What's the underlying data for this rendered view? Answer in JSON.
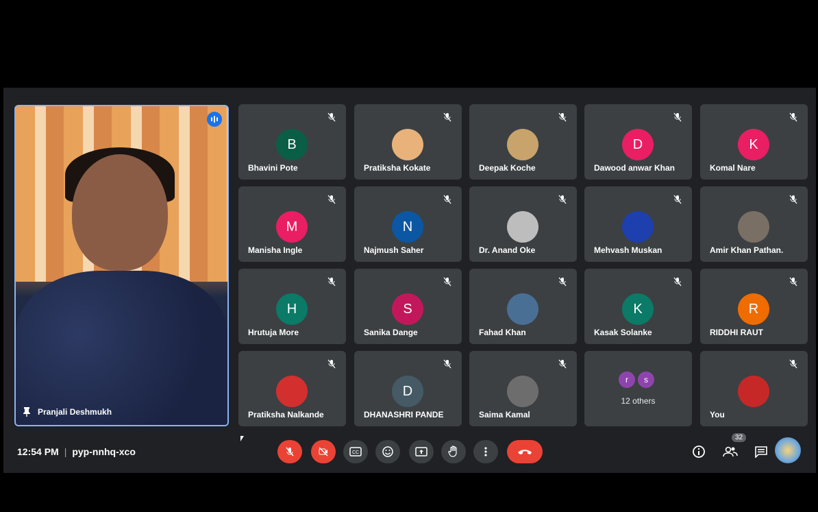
{
  "featured": {
    "name": "Pranjali Deshmukh"
  },
  "tiles": [
    {
      "name": "Bhavini Pote",
      "initial": "B",
      "color": "#0b5e46"
    },
    {
      "name": "Pratiksha Kokate",
      "initial": "",
      "color": "#e9b27a"
    },
    {
      "name": "Deepak Koche",
      "initial": "",
      "color": "#c8a36b"
    },
    {
      "name": "Dawood anwar Khan",
      "initial": "D",
      "color": "#e91e63"
    },
    {
      "name": "Komal Nare",
      "initial": "K",
      "color": "#e91e63"
    },
    {
      "name": "Manisha Ingle",
      "initial": "M",
      "color": "#e91e63"
    },
    {
      "name": "Najmush Saher",
      "initial": "N",
      "color": "#0b57a3"
    },
    {
      "name": "Dr. Anand Oke",
      "initial": "",
      "color": "#bdbdbd"
    },
    {
      "name": "Mehvash Muskan",
      "initial": "",
      "color": "#1e3fae"
    },
    {
      "name": "Amir Khan Pathan.",
      "initial": "",
      "color": "#7a6f65"
    },
    {
      "name": "Hrutuja More",
      "initial": "H",
      "color": "#0b7a66"
    },
    {
      "name": "Sanika Dange",
      "initial": "S",
      "color": "#c2185b"
    },
    {
      "name": "Fahad Khan",
      "initial": "",
      "color": "#4a6f95"
    },
    {
      "name": "Kasak Solanke",
      "initial": "K",
      "color": "#0b7a66"
    },
    {
      "name": "RIDDHI RAUT",
      "initial": "R",
      "color": "#ef6c00"
    },
    {
      "name": "Pratiksha Nalkande",
      "initial": "",
      "color": "#d32f2f"
    },
    {
      "name": "DHANASHRI PANDE",
      "initial": "D",
      "color": "#455a64"
    },
    {
      "name": "Saima Kamal",
      "initial": "",
      "color": "#6d6d6d"
    },
    {
      "name": "12 others",
      "initial": "",
      "color": ""
    },
    {
      "name": "You",
      "initial": "",
      "color": "#c62828"
    }
  ],
  "others": {
    "label": "12 others",
    "a": "r",
    "b": "s",
    "color_a": "#8e44ad",
    "color_b": "#8e44ad"
  },
  "bottom": {
    "time": "12:54 PM",
    "separator": "|",
    "code": "pyp-nnhq-xco",
    "participants_count": "32"
  },
  "icons": {
    "mic": "mic-off-icon",
    "cam": "camera-off-icon",
    "cc": "captions-icon",
    "emoji": "emoji-icon",
    "present": "present-screen-icon",
    "hand": "raise-hand-icon",
    "more": "more-vert-icon",
    "end": "end-call-icon",
    "info": "info-icon",
    "people": "people-icon",
    "chat": "chat-icon"
  }
}
